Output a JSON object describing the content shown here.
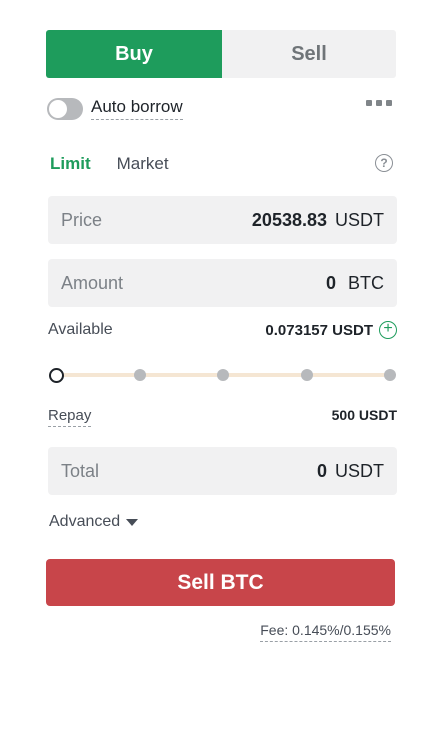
{
  "tabs": {
    "buy": "Buy",
    "sell": "Sell"
  },
  "auto_borrow": {
    "label": "Auto borrow",
    "enabled": false
  },
  "order_types": {
    "limit": "Limit",
    "market": "Market",
    "help_icon": "question-circle-icon",
    "help_glyph": "?"
  },
  "price": {
    "label": "Price",
    "value": "20538.83",
    "unit": "USDT"
  },
  "amount": {
    "label": "Amount",
    "value": "0",
    "unit": "BTC"
  },
  "available": {
    "label": "Available",
    "value": "0.073157 USDT",
    "plus_glyph": "+"
  },
  "slider": {
    "value_percent": 0,
    "steps": [
      0,
      25,
      50,
      75,
      100
    ]
  },
  "repay": {
    "label": "Repay",
    "value": "500 USDT"
  },
  "total": {
    "label": "Total",
    "value": "0",
    "unit": "USDT"
  },
  "advanced": {
    "label": "Advanced"
  },
  "action": {
    "label": "Sell BTC"
  },
  "fee": {
    "label": "Fee: 0.145%/0.155%"
  },
  "colors": {
    "green": "#1e9c5c",
    "red": "#c8454a",
    "slider_track": "#f5e6d3"
  }
}
